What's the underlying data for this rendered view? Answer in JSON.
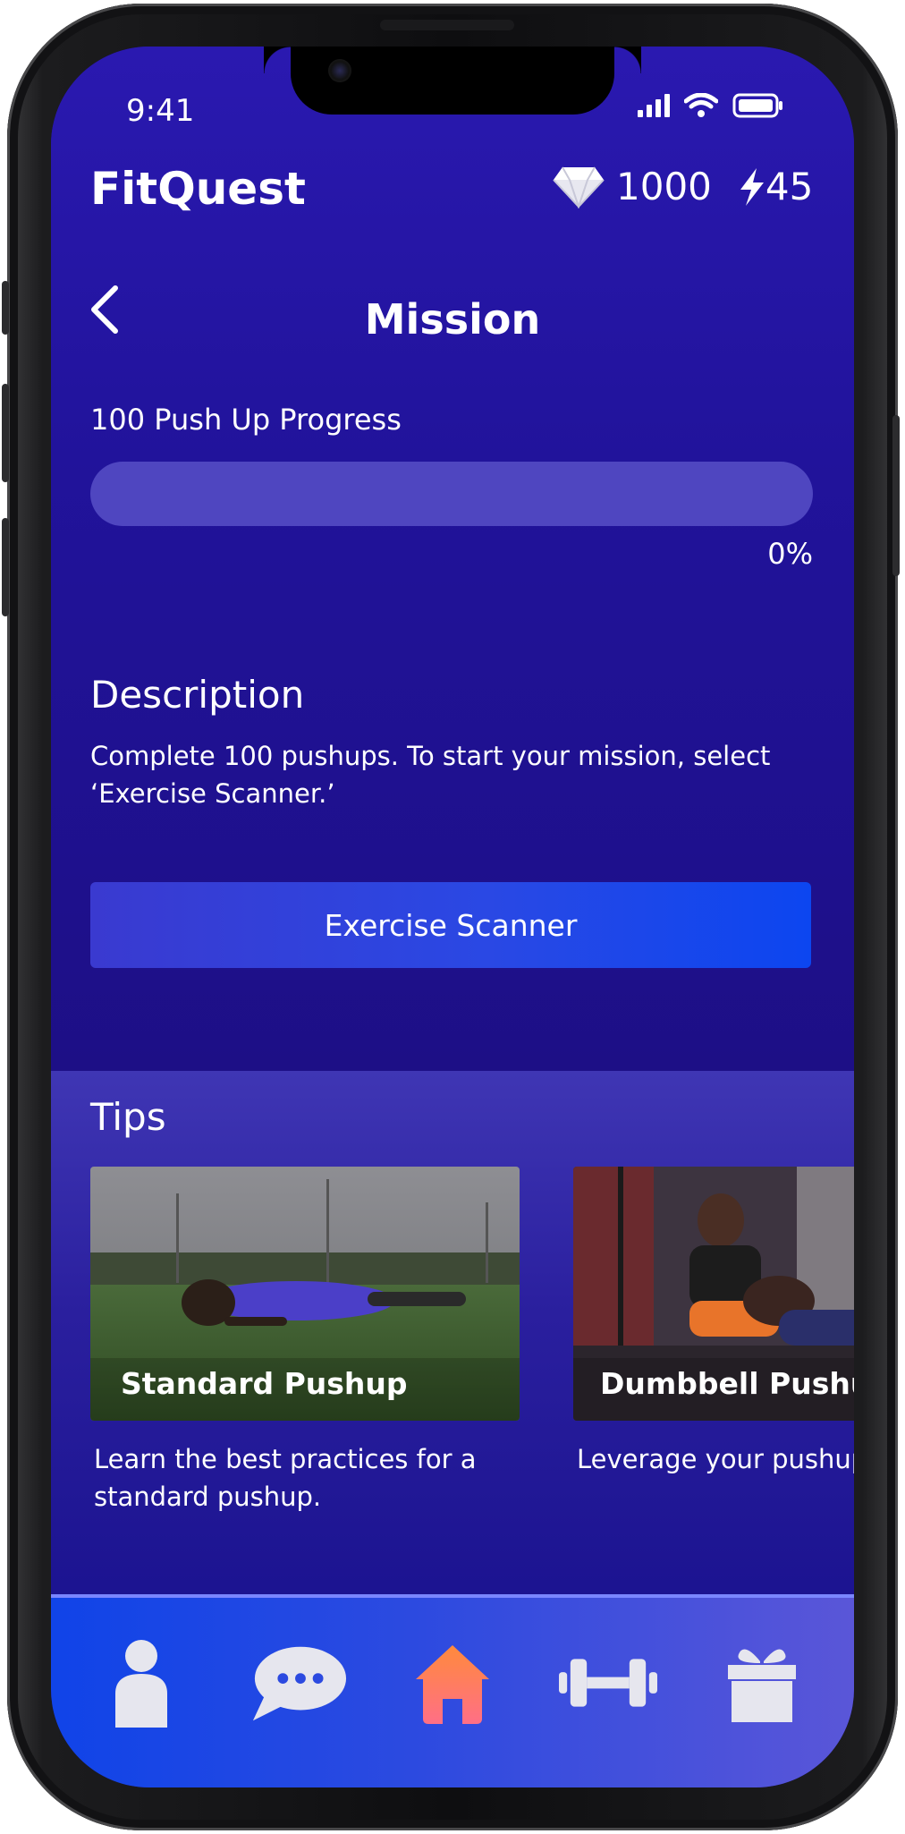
{
  "status_bar": {
    "time": "9:41"
  },
  "header": {
    "brand": "FitQuest",
    "gems_icon": "diamond-icon",
    "gems": "1000",
    "energy_icon": "lightning-icon",
    "energy": "45"
  },
  "page": {
    "title": "Mission",
    "back_icon": "chevron-left-icon"
  },
  "progress": {
    "label": "100 Push Up Progress",
    "value_text": "0%",
    "value_fraction": 0
  },
  "description": {
    "title": "Description",
    "text": "Complete 100 pushups. To start your mission, select ‘Exercise Scanner.’"
  },
  "actions": {
    "scanner_label": "Exercise Scanner"
  },
  "tips": {
    "title": "Tips",
    "cards": [
      {
        "title": "Standard Pushup",
        "text": "Learn the best practices for a standard pushup."
      },
      {
        "title": "Dumbbell Pushup",
        "text": "Leverage your pushup with a dumbell."
      }
    ]
  },
  "nav": {
    "items": [
      {
        "icon": "profile-icon",
        "active": false
      },
      {
        "icon": "chat-icon",
        "active": false
      },
      {
        "icon": "home-icon",
        "active": true
      },
      {
        "icon": "dumbbell-icon",
        "active": false
      },
      {
        "icon": "gift-icon",
        "active": false
      }
    ]
  },
  "colors": {
    "background": "#22129e",
    "accent_button": "#0c46f0",
    "progress_track": "#4f46c0",
    "nav_active": "#ff8a3c"
  }
}
